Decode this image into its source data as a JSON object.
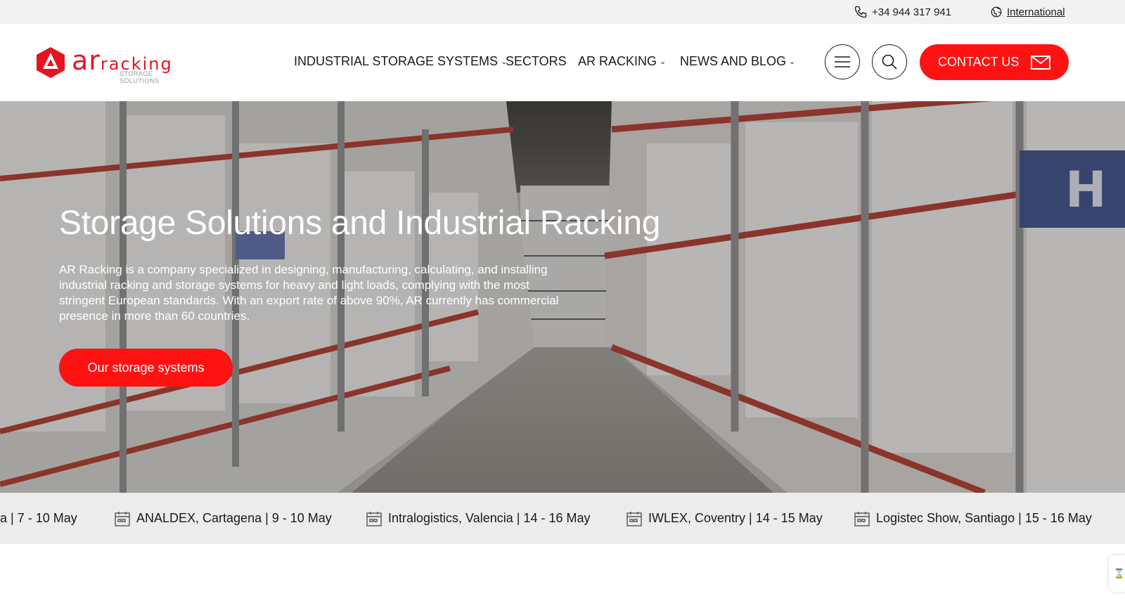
{
  "topbar": {
    "phone": "+34 944 317 941",
    "international": "International"
  },
  "logo": {
    "brand_prefix": "ar",
    "brand_suffix": "racking",
    "tagline": "STORAGE SOLUTIONS"
  },
  "nav": {
    "items": [
      {
        "label": "INDUSTRIAL STORAGE SYSTEMS",
        "dropdown": true
      },
      {
        "label": "SECTORS",
        "dropdown": false
      },
      {
        "label": "AR RACKING",
        "dropdown": true
      },
      {
        "label": "NEWS AND BLOG",
        "dropdown": true
      }
    ],
    "contact_label": "CONTACT US"
  },
  "hero": {
    "title": "Storage Solutions and Industrial Racking",
    "description": "AR Racking is a company specialized in designing, manufacturing, calculating, and installing industrial racking and storage systems for heavy and light loads, complying with the most stringent European standards. With an export rate of above 90%, AR currently has commercial presence in more than 60 countries.",
    "cta_label": "Our storage systems"
  },
  "events": [
    "a | 7 - 10 May",
    "ANALDEX, Cartagena | 9 - 10 May",
    "Intralogistics, Valencia | 14 - 16 May",
    "IWLEX, Coventry | 14 - 15 May",
    "Logistec Show, Santiago | 15 - 16 May"
  ],
  "icons": {
    "phone": "phone-icon",
    "international": "globe-icon",
    "menu": "hamburger-menu-icon",
    "search": "search-icon",
    "contact": "envelope-icon",
    "event": "calendar-icon"
  },
  "colors": {
    "accent": "#ff1212",
    "topbar_bg": "#f2f2f2",
    "ticker_bg": "#ececec"
  }
}
